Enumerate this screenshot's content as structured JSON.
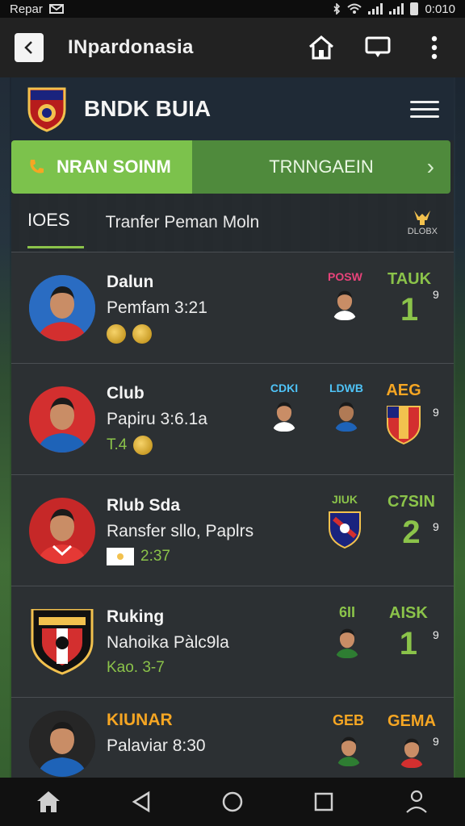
{
  "status_bar": {
    "left_text": "Repar",
    "time": "0:010"
  },
  "app_bar": {
    "title": "INpardonasia"
  },
  "header": {
    "title": "BNDK BUIA"
  },
  "tabs": {
    "active": "NRAN SOINM",
    "other": "TRNNGAEIN"
  },
  "sub": {
    "tab": "IOES",
    "title": "Tranfer Peman Moln",
    "badge": "DLOBX"
  },
  "colors": {
    "accent": "#8bc34a",
    "tab_active": "#7cc24c",
    "tab_other": "#4f8a3c"
  },
  "cards": [
    {
      "name": "Dalun",
      "line": "Pemfam 3:21",
      "meta": "",
      "col1_label": "POSW",
      "col3_label": "TAUK",
      "stat": "1",
      "sup": "9"
    },
    {
      "name": "Club",
      "line": "Papiru 3:6.1a",
      "meta": "T.4",
      "col1_label": "CDKI",
      "col2_label": "LDWB",
      "col3_label": "AEG",
      "sup": "9"
    },
    {
      "name": "Rlub Sda",
      "line": "Ransfer sllo, Paplrs",
      "meta": "2:37",
      "col1_label": "JIUK",
      "col3_label": "C7SIN",
      "stat": "2",
      "sup": "9"
    },
    {
      "name": "Ruking",
      "line": "Nahoika Pàlc9la",
      "meta": "Kao. 3-7",
      "col1_label": "6II",
      "col3_label": "AISK",
      "stat": "1",
      "sup": "9"
    },
    {
      "name": "KIUNAR",
      "line": "Palaviar 8:30",
      "meta": "",
      "col1_label": "GEB",
      "col3_label": "GEMA",
      "sup": "9"
    }
  ],
  "icons": [
    "back-icon",
    "home-icon",
    "cast-icon",
    "more-vert-icon",
    "menu-icon",
    "phone-icon",
    "chevron-right-icon",
    "trophy-icon",
    "nav-home-icon",
    "nav-back-icon",
    "nav-circle-icon",
    "nav-square-icon",
    "nav-profile-icon"
  ]
}
